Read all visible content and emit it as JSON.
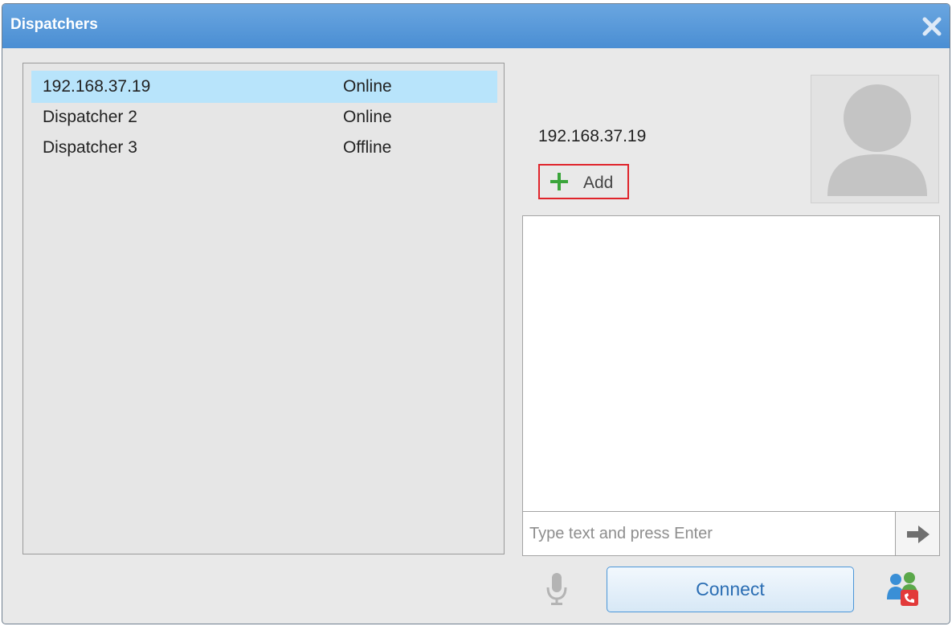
{
  "window": {
    "title": "Dispatchers"
  },
  "dispatchers": [
    {
      "name": "192.168.37.19",
      "status": "Online",
      "selected": true
    },
    {
      "name": "Dispatcher 2",
      "status": "Online",
      "selected": false
    },
    {
      "name": "Dispatcher 3",
      "status": "Offline",
      "selected": false
    }
  ],
  "contact": {
    "name": "192.168.37.19",
    "add_label": "Add"
  },
  "message": {
    "placeholder": "Type text and press Enter",
    "value": ""
  },
  "actions": {
    "connect_label": "Connect"
  },
  "icons": {
    "close": "close-icon",
    "add": "plus-icon",
    "avatar": "user-avatar-icon",
    "send": "arrow-right-icon",
    "mic": "microphone-icon",
    "conference": "users-call-icon"
  },
  "colors": {
    "titlebar": "#4a8ed3",
    "selected_row": "#b8e4fb",
    "add_highlight": "#e0242b",
    "plus": "#3aa53a",
    "connect_text": "#2a6db3"
  }
}
